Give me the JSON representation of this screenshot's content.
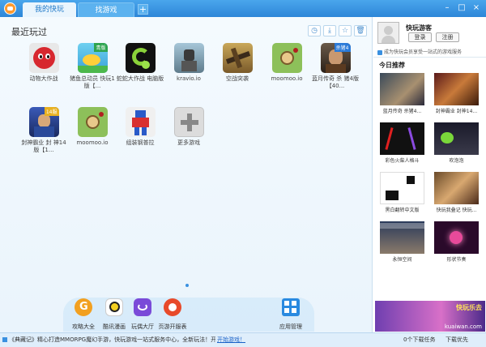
{
  "tabs": {
    "active": "我的快玩",
    "inactive": "找游戏",
    "add": "+"
  },
  "window": {
    "minimize": "–",
    "maximize": "□",
    "close": "×"
  },
  "main": {
    "section_title": "最近玩过",
    "toolbar": {
      "history": "◷",
      "download": "⤓",
      "favorite": "☆",
      "delete": "🗑"
    },
    "games": [
      {
        "name": "动物大作战",
        "icon": "mole-icon"
      },
      {
        "name": "猪鱼总动员 快玩1版【...",
        "icon": "fish-icon",
        "badge": "青版"
      },
      {
        "name": "蛇蛇大作战 电脑版",
        "icon": "snake-icon"
      },
      {
        "name": "kravio.io",
        "icon": "knight-icon"
      },
      {
        "name": "空战突袭",
        "icon": "plane-icon"
      },
      {
        "name": "moomoo.io",
        "icon": "moomoo-icon"
      },
      {
        "name": "蓝月传奇 杀 猪4版【40...",
        "icon": "warrior-icon",
        "badge": "杀猪4"
      },
      {
        "name": "封神霸业 封 神14版【1...",
        "icon": "hero-icon",
        "badge": "14服"
      },
      {
        "name": "moomoo.io",
        "icon": "moomoo-icon"
      },
      {
        "name": "组装钢普拉",
        "icon": "robot-icon"
      },
      {
        "name": "更多游戏",
        "icon": "plus-icon"
      }
    ],
    "dock": [
      {
        "label": "攻略大全",
        "icon": "guide-icon"
      },
      {
        "label": "酷讯漫画",
        "icon": "comic-icon"
      },
      {
        "label": "玩偶大厅",
        "icon": "hall-icon"
      },
      {
        "label": "页游开服表",
        "icon": "server-icon"
      },
      {
        "label": "应用管理",
        "icon": "apps-icon"
      }
    ]
  },
  "sidebar": {
    "username": "快玩游客",
    "login": "登录",
    "register": "注册",
    "tagline": "成为快玩会员享受一站式的游戏服务",
    "rec_title": "今日推荐",
    "recs": [
      {
        "name": "蓝月传奇 杀猪4..."
      },
      {
        "name": "封神霸业 封神14..."
      },
      {
        "name": "彩色火柴人格斗"
      },
      {
        "name": "吹泡泡"
      },
      {
        "name": "黑白翻转中文版"
      },
      {
        "name": "快玩我叠记 快玩..."
      },
      {
        "name": "永恒空间"
      },
      {
        "name": "形状节奏"
      }
    ],
    "banner_text": "快玩乐去",
    "banner_url": "kuaiwan.com"
  },
  "status": {
    "notice": "《典藏记》精心打造MMORPG魔幻手游，快玩游戏一站式服务中心，全新玩法！开放，自由，真...",
    "start_link": "开始游戏！",
    "downloads": "0个下载任务",
    "speed": "下载优先"
  }
}
